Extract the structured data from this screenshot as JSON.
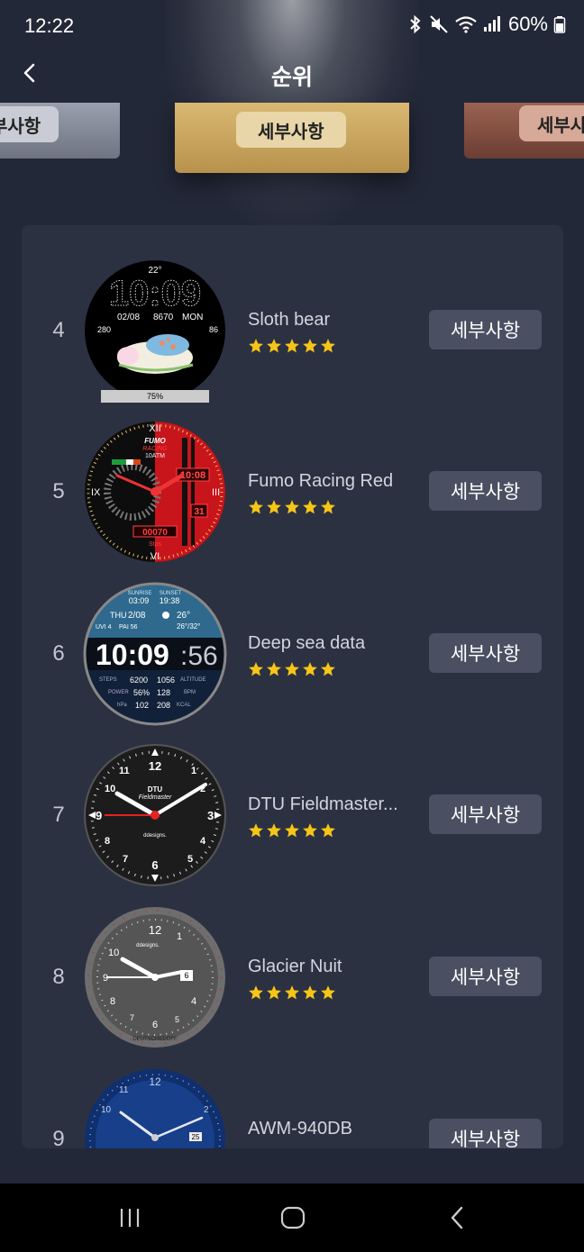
{
  "status_bar": {
    "time": "12:22",
    "battery": "60%",
    "icons": [
      "bluetooth-icon",
      "mute-icon",
      "wifi-icon",
      "signal-icon",
      "battery-icon"
    ]
  },
  "header": {
    "title": "순위",
    "back_icon": "chevron-left-icon"
  },
  "podium": {
    "left_button": "부사항",
    "center_button": "세부사항",
    "right_button": "세부사"
  },
  "ranking": [
    {
      "rank": "4",
      "name": "Sloth bear",
      "rating": 5,
      "button": "세부사항",
      "face": {
        "temp": "22°",
        "time": "10:09",
        "date": "02/08",
        "steps": "8670",
        "day": "MON",
        "left_val": "280",
        "right_val": "86",
        "battery": "75%"
      }
    },
    {
      "rank": "5",
      "name": "Fumo Racing Red",
      "rating": 5,
      "button": "세부사항",
      "face": {
        "brand": "FUMO",
        "sub": "RACING",
        "atm": "10ATM",
        "time": "10:08",
        "date": "31",
        "counter": "00070",
        "unit": "Stps",
        "numeral_top": "XII",
        "numeral_left": "IX",
        "numeral_right": "III",
        "numeral_bottom": "VI"
      }
    },
    {
      "rank": "6",
      "name": "Deep sea data",
      "rating": 5,
      "button": "세부사항",
      "face": {
        "sunrise_label": "SUNRISE",
        "sunset_label": "SUNSET",
        "sunrise": "03:09",
        "sunset": "19:38",
        "day": "THU",
        "date": "2/08",
        "temp": "26°",
        "temp_range": "26°/32°",
        "uv": "UVI 4",
        "pai": "PAI 56",
        "hh": "10:09",
        "ss": ":56",
        "steps_label": "STEPS",
        "steps": "6200",
        "altitude": "1056",
        "altitude_label": "ALTITUDE",
        "power_label": "POWER",
        "power": "56%",
        "bpm": "128",
        "bpm_label": "BPM",
        "hpa_label": "hPa",
        "hpa": "102",
        "kcal": "208",
        "kcal_label": "KCAL"
      }
    },
    {
      "rank": "7",
      "name": "DTU Fieldmaster...",
      "rating": 5,
      "button": "세부사항",
      "face": {
        "brand": "DTU",
        "model": "Fieldmaster",
        "maker": "ddesigns."
      }
    },
    {
      "rank": "8",
      "name": "Glacier Nuit",
      "rating": 5,
      "button": "세부사항",
      "face": {
        "maker": "ddesigns.",
        "date": "6",
        "bottom_text": "DEUTSCHEDOFF"
      }
    },
    {
      "rank": "9",
      "name": "AWM-940DB",
      "rating": 5,
      "button": "세부사항",
      "face": {
        "date": "25"
      }
    }
  ],
  "colors": {
    "background": "#232838",
    "card": "#2c3142",
    "button": "#4a5062",
    "star": "#f5c518",
    "gold": "#c9a55f"
  },
  "nav_bar": {
    "recents_icon": "recents-icon",
    "home_icon": "home-icon",
    "back_icon": "back-icon"
  }
}
